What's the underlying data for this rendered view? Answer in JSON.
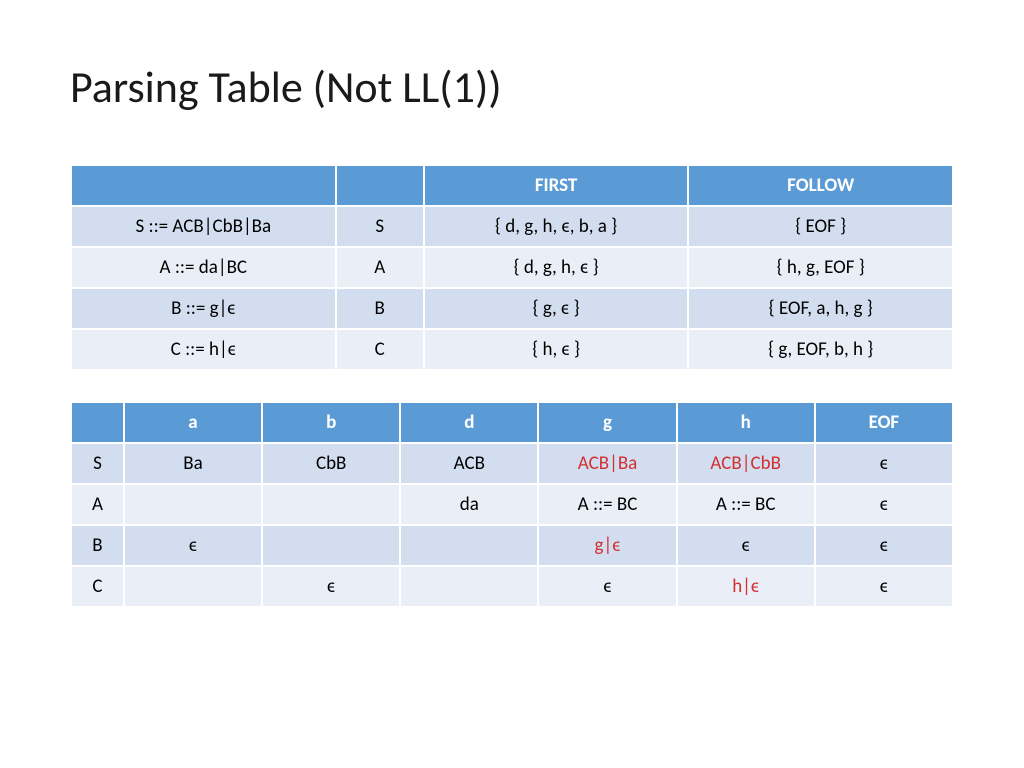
{
  "title": "Parsing Table (Not LL(1))",
  "table1": {
    "headers": {
      "c1": "",
      "c2": "",
      "c3": "FIRST",
      "c4": "FOLLOW"
    },
    "rows": [
      {
        "grammar": "S ::= ACB|CbB|Ba",
        "nt": "S",
        "first": "{ d, g, h, ϵ, b, a }",
        "follow": "{ EOF }"
      },
      {
        "grammar": "A ::= da|BC",
        "nt": "A",
        "first": "{ d, g, h, ϵ }",
        "follow": "{ h, g, EOF }"
      },
      {
        "grammar": "B ::= g|ϵ",
        "nt": "B",
        "first": "{ g, ϵ }",
        "follow": "{ EOF, a, h, g }"
      },
      {
        "grammar": "C ::= h|ϵ",
        "nt": "C",
        "first": "{ h, ϵ }",
        "follow": "{ g, EOF, b, h }"
      }
    ]
  },
  "table2": {
    "headers": {
      "c0": "",
      "a": "a",
      "b": "b",
      "d": "d",
      "g": "g",
      "h": "h",
      "eof": "EOF"
    },
    "rows": [
      {
        "nt": "S",
        "a": "Ba",
        "b": "CbB",
        "d": "ACB",
        "g": "ACB|Ba",
        "g_conf": true,
        "h": "ACB|CbB",
        "h_conf": true,
        "eof": "ϵ"
      },
      {
        "nt": "A",
        "a": "",
        "b": "",
        "d": "da",
        "g": "A ::= BC",
        "g_conf": false,
        "h": "A ::= BC",
        "h_conf": false,
        "eof": "ϵ"
      },
      {
        "nt": "B",
        "a": "ϵ",
        "b": "",
        "d": "",
        "g": "g|ϵ",
        "g_conf": true,
        "h": "ϵ",
        "h_conf": false,
        "eof": "ϵ"
      },
      {
        "nt": "C",
        "a": "",
        "b": "ϵ",
        "d": "",
        "g": "ϵ",
        "g_conf": false,
        "h": "h|ϵ",
        "h_conf": true,
        "eof": "ϵ"
      }
    ]
  }
}
